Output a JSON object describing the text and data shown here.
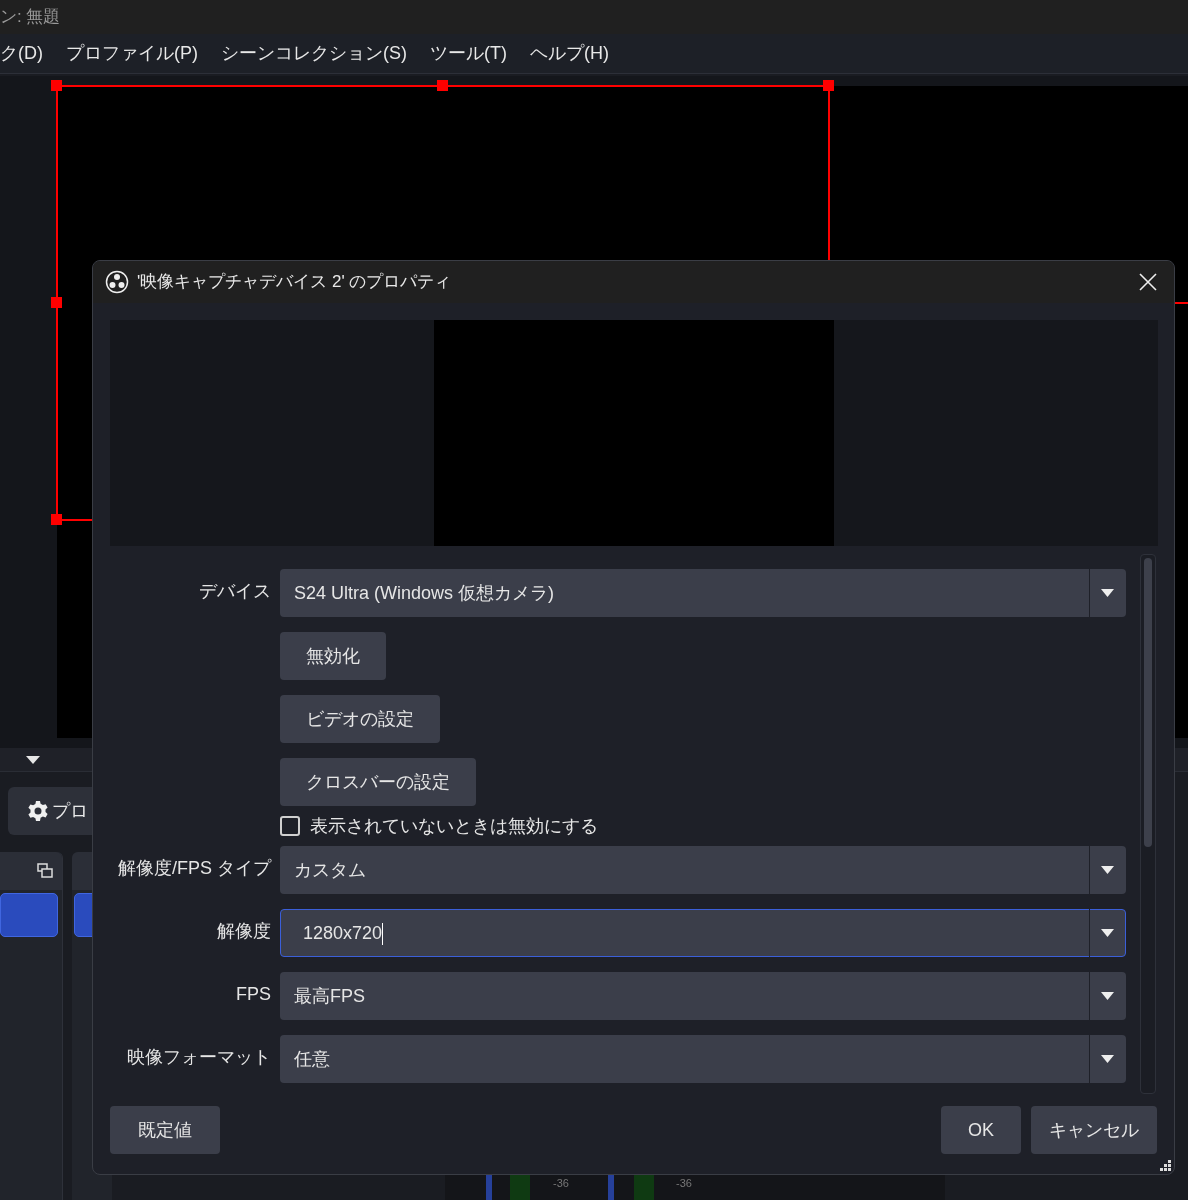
{
  "window": {
    "title": "ン: 無題"
  },
  "menu": [
    "ク(D)",
    "プロファイル(P)",
    "シーンコレクション(S)",
    "ツール(T)",
    "ヘルプ(H)"
  ],
  "properties_button": {
    "label": "プロ"
  },
  "docks": [
    {
      "selected": true
    },
    {
      "selected": true
    }
  ],
  "meters": [
    "-36",
    "-36"
  ],
  "dialog": {
    "title": "'映像キャプチャデバイス 2' のプロパティ",
    "fields": [
      {
        "kind": "select",
        "label": "デバイス",
        "value": "S24 Ultra (Windows 仮想カメラ)",
        "focused": false
      },
      {
        "kind": "button",
        "label": "無効化"
      },
      {
        "kind": "button",
        "label": "ビデオの設定"
      },
      {
        "kind": "button",
        "label": "クロスバーの設定"
      },
      {
        "kind": "checkbox",
        "label": "表示されていないときは無効にする",
        "checked": false
      },
      {
        "kind": "select",
        "label": "解像度/FPS タイプ",
        "value": "カスタム",
        "focused": false
      },
      {
        "kind": "select",
        "label": "解像度",
        "value": "1280x720",
        "focused": true
      },
      {
        "kind": "select",
        "label": "FPS",
        "value": "最高FPS",
        "focused": false
      },
      {
        "kind": "select",
        "label": "映像フォーマット",
        "value": "任意",
        "focused": false
      }
    ],
    "defaults_button": "既定値",
    "buttons": [
      "OK",
      "キャンセル"
    ]
  }
}
